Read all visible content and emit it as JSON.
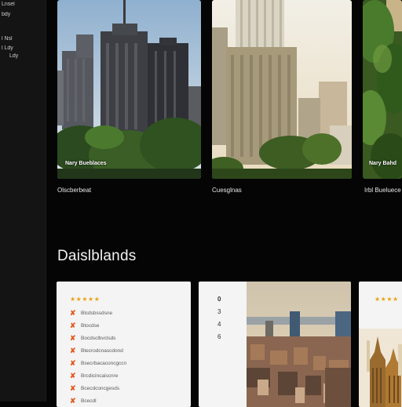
{
  "sidebar": {
    "items": [
      "Lnsel",
      "bdy",
      "l Nsl",
      "l Ldy",
      "Ldy"
    ]
  },
  "gallery": {
    "cards": [
      {
        "tag": "Nary Bueblaces",
        "caption": "Olscberbeat"
      },
      {
        "tag": "",
        "caption": "Cuesglnas"
      },
      {
        "tag": "Nary Bahd",
        "caption": "Irbl Bueluece"
      }
    ]
  },
  "section": {
    "title": "Daislblands"
  },
  "panel1": {
    "stars": "★★★★★",
    "items": [
      "Blcdsbssdsne",
      "Btocdse",
      "Bocdsclbvclsds",
      "Btecrodcnascdond",
      "Bsecrbacaconcgccn",
      "Brcdicincaiscnre",
      "Bcecdconcgesds",
      "Bcecdl"
    ]
  },
  "panel2": {
    "numbers": [
      "0",
      "3",
      "4",
      "6"
    ]
  },
  "panel3": {
    "stars": "★★★★"
  },
  "colors": {
    "accent": "#e45a1d",
    "star": "#e8a317",
    "background": "#050505"
  }
}
